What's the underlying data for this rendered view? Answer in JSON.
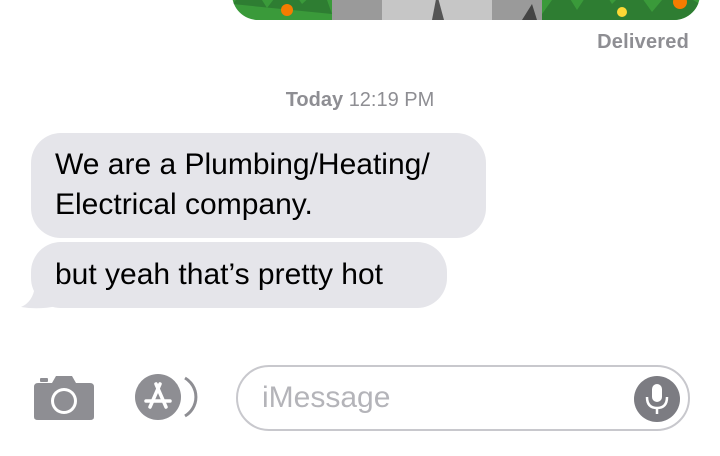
{
  "thread": {
    "delivery_status": "Delivered",
    "timestamp": {
      "day": "Today",
      "time": "12:19 PM"
    }
  },
  "messages": [
    {
      "direction": "incoming",
      "lines": [
        "We are a Plumbing/Heating/",
        "Electrical company."
      ]
    },
    {
      "direction": "incoming",
      "lines": [
        "but yeah that’s pretty hot"
      ]
    }
  ],
  "compose": {
    "placeholder": "iMessage",
    "camera_icon": "camera-icon",
    "apps_icon": "app-store-icon",
    "mic_icon": "microphone-icon"
  },
  "colors": {
    "incoming_bubble": "#e5e5ea",
    "meta_text": "#8e8e93",
    "icon_gray": "#8e8e93",
    "mic_gray": "#7c7c82"
  }
}
